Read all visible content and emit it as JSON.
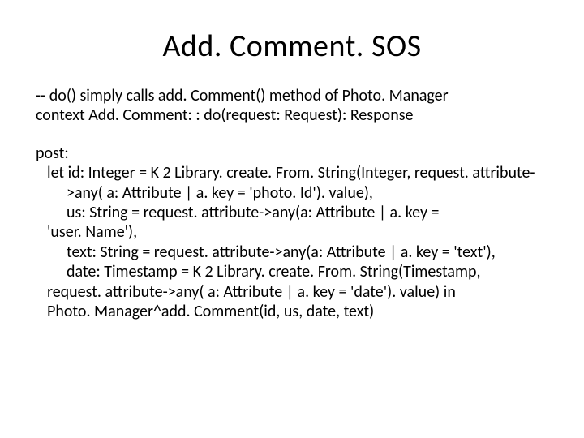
{
  "title": "Add. Comment. SOS",
  "block1": {
    "l1": "-- do() simply calls add. Comment() method of Photo. Manager",
    "l2": "context Add. Comment: : do(request: Request): Response"
  },
  "block2": {
    "l1": "post:",
    "l2": "let id: Integer = K 2 Library. create. From. String(Integer, request. attribute-",
    "l3": ">any( a: Attribute | a. key = 'photo. Id'). value),",
    "l4": "us: String = request. attribute->any(a: Attribute | a. key =",
    "l5": "'user. Name'),",
    "l6": "text: String = request. attribute->any(a: Attribute | a. key = 'text'),",
    "l7": "date: Timestamp = K 2 Library. create. From. String(Timestamp,",
    "l8": "request. attribute->any( a: Attribute | a. key = 'date'). value) in",
    "l9": "Photo. Manager^add. Comment(id, us, date, text)"
  }
}
